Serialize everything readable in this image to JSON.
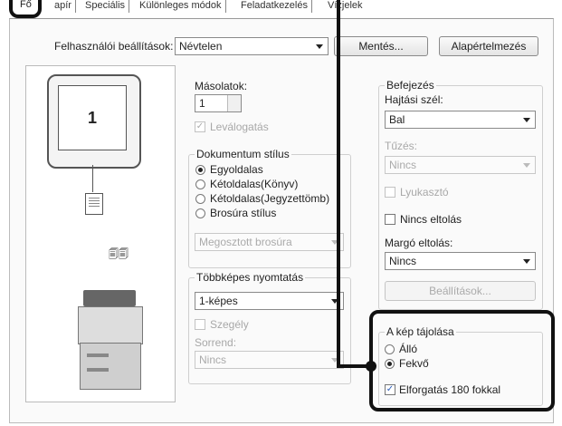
{
  "tabs": [
    "Fő",
    "apír",
    "Speciális",
    "Különleges módok",
    "Feladatkezelés",
    "Vízjelek"
  ],
  "user_settings": {
    "label": "Felhasználói beállítások:",
    "value": "Névtelen",
    "save": "Mentés...",
    "defaults": "Alapértelmezés"
  },
  "preview": {
    "page_number": "1"
  },
  "copies": {
    "label": "Másolatok:",
    "value": "1"
  },
  "collate": {
    "label": "Leválogatás"
  },
  "doc_style": {
    "title": "Dokumentum stílus",
    "options": [
      "Egyoldalas",
      "Kétoldalas(Könyv)",
      "Kétoldalas(Jegyzettömb)",
      "Brosúra stílus"
    ],
    "selected": "Egyoldalas",
    "split_booklet": "Megosztott brosúra"
  },
  "multipage": {
    "title": "Többképes nyomtatás",
    "value": "1-képes",
    "border": "Szegély",
    "order_label": "Sorrend:",
    "order_value": "Nincs"
  },
  "finishing": {
    "title": "Befejezés",
    "binding_label": "Hajtási szél:",
    "binding_value": "Bal",
    "staple_label": "Tűzés:",
    "staple_value": "Nincs",
    "punch": "Lyukasztó",
    "no_offset": "Nincs eltolás",
    "margin_label": "Margó eltolás:",
    "margin_value": "Nincs",
    "settings": "Beállítások..."
  },
  "orientation": {
    "title": "A kép tájolása",
    "portrait": "Álló",
    "landscape": "Fekvő",
    "selected": "Fekvő",
    "rotate": "Elforgatás 180 fokkal",
    "rotate_checked": true
  }
}
